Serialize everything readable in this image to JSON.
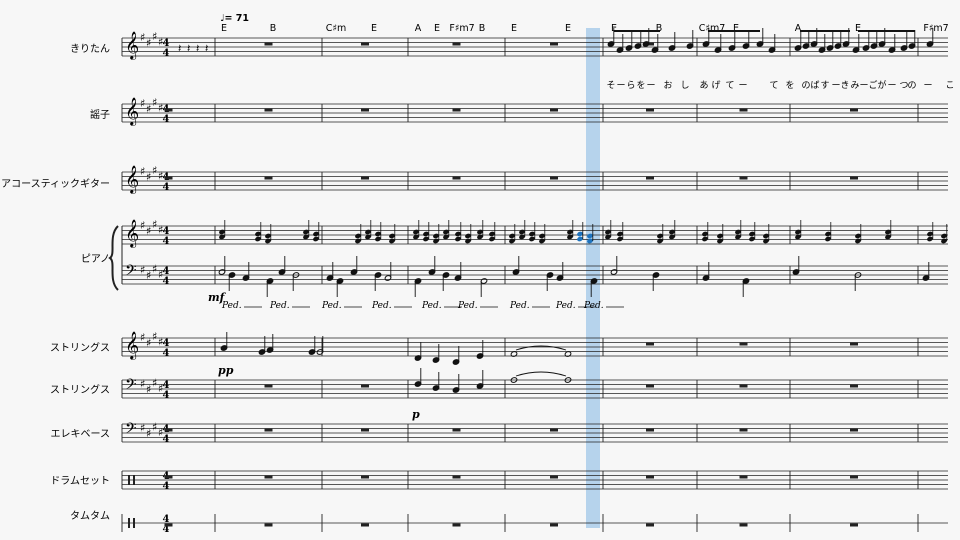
{
  "tempo": "♩= 71",
  "instruments": [
    {
      "id": "kiritan",
      "label": "きりたん"
    },
    {
      "id": "koto",
      "label": "謡子"
    },
    {
      "id": "acoustic-guitar",
      "label": "アコースティックギター"
    },
    {
      "id": "piano",
      "label": "ピアノ"
    },
    {
      "id": "strings-treble",
      "label": "ストリングス"
    },
    {
      "id": "strings-bass",
      "label": "ストリングス"
    },
    {
      "id": "electric-bass",
      "label": "エレキベース"
    },
    {
      "id": "drum-set",
      "label": "ドラムセット"
    },
    {
      "id": "tom-tom",
      "label": "タムタム"
    }
  ],
  "time_signature": {
    "top": "4",
    "bottom": "4"
  },
  "chords": [
    "E",
    "B",
    "C♯m",
    "E",
    "A",
    "E",
    "F♯m7",
    "B",
    "E",
    "E",
    "E",
    "B",
    "C♯m7",
    "E",
    "A",
    "E",
    "F♯m7"
  ],
  "lyrics": [
    "そ",
    "ー",
    "ら",
    "を",
    "ー",
    "お",
    "し",
    "あ",
    "げ",
    "て",
    "ー",
    "て",
    "を",
    "の",
    "ば",
    "す",
    "ー",
    "き",
    "み",
    "ー",
    "ご",
    "が",
    "ー",
    "つ",
    "の",
    "ー",
    "こ"
  ],
  "dynamics": {
    "piano": "mf",
    "strings_treble": "pp",
    "strings_bass": "p"
  },
  "piano_pedal_marks": [
    "𝆮",
    "𝆮",
    "𝆮",
    "𝆮",
    "𝆮",
    "𝆮",
    "𝆮",
    "𝆮",
    "𝆮"
  ],
  "colors": {
    "playhead": "#b6d3ec",
    "selected_note": "#1e73be",
    "page": "#f7f7f7",
    "ink": "#111111"
  }
}
